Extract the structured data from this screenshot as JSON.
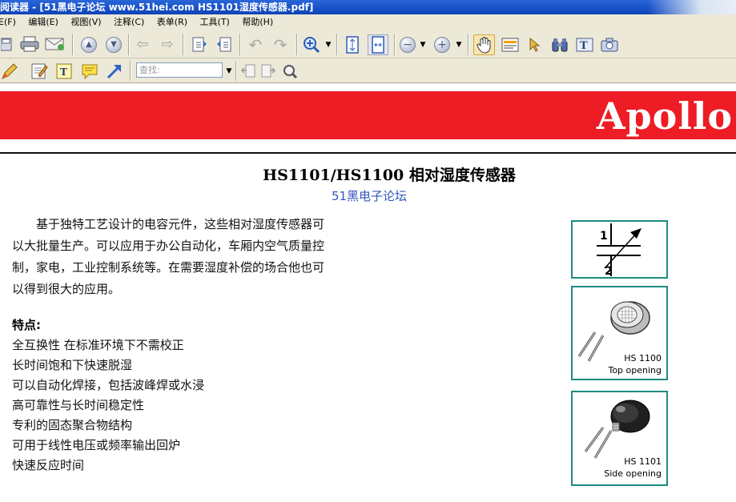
{
  "window": {
    "title": "阅读器 - [51黑电子论坛 www.51hei.com HS1101湿度传感器.pdf]"
  },
  "menu": [
    "E(F)",
    "编辑(E)",
    "视图(V)",
    "注释(C)",
    "表单(R)",
    "工具(T)",
    "帮助(H)"
  ],
  "toolbar": {
    "find_placeholder": "查找:"
  },
  "document": {
    "brand": "Apollo",
    "title": "HS1101/HS1100 相对湿度传感器",
    "subtitle": "51黑电子论坛",
    "paragraph_lines": [
      "　　基于独特工艺设计的电容元件，这些相对湿度传感器可",
      "以大批量生产。可以应用于办公自动化，车厢内空气质量控",
      "制，家电，工业控制系统等。在需要湿度补偿的场合他也可",
      "以得到很大的应用。"
    ],
    "features_heading": "特点:",
    "features": [
      "全互换性  在标准环境下不需校正",
      "长时间饱和下快速脱湿",
      "可以自动化焊接，包括波峰焊或水浸",
      "高可靠性与长时间稳定性",
      "专利的固态聚合物结构",
      "可用于线性电压或频率输出回炉",
      "快速反应时间"
    ],
    "figures": {
      "symbol_pin1": "1",
      "symbol_pin2": "2",
      "top_model": "HS 1100",
      "top_caption": "Top opening",
      "side_model": "HS 1101",
      "side_caption": "Side opening"
    }
  },
  "colors": {
    "banner": "#ee1c25",
    "subtitle": "#3556b8",
    "figure_border": "#1e8a80",
    "titlebar": "#1750c8"
  }
}
